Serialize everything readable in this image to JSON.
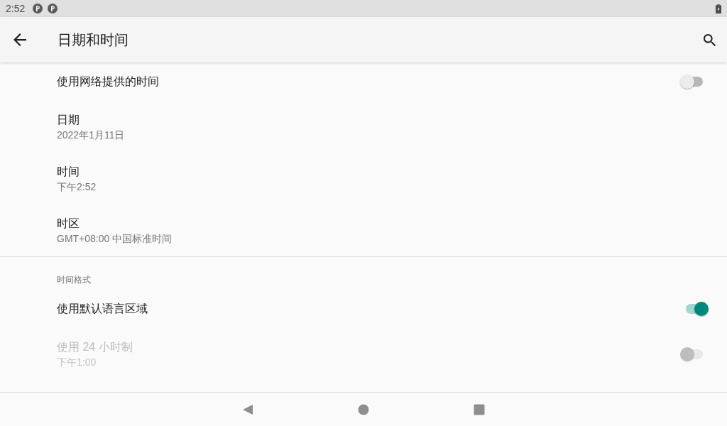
{
  "status_bar": {
    "time": "2:52"
  },
  "app_bar": {
    "title": "日期和时间"
  },
  "sections": [
    {
      "items": [
        {
          "kind": "switch",
          "title": "使用网络提供的时间",
          "on": false,
          "disabled": false
        },
        {
          "kind": "detail",
          "title": "日期",
          "summary": "2022年1月11日",
          "disabled": false
        },
        {
          "kind": "detail",
          "title": "时间",
          "summary": "下午2:52",
          "disabled": false
        },
        {
          "kind": "detail",
          "title": "时区",
          "summary": "GMT+08:00 中国标准时间",
          "disabled": false
        }
      ]
    },
    {
      "header": "时间格式",
      "items": [
        {
          "kind": "switch",
          "title": "使用默认语言区域",
          "on": true,
          "disabled": false
        },
        {
          "kind": "switch",
          "title": "使用 24 小时制",
          "summary": "下午1:00",
          "on": false,
          "disabled": true
        }
      ]
    }
  ]
}
